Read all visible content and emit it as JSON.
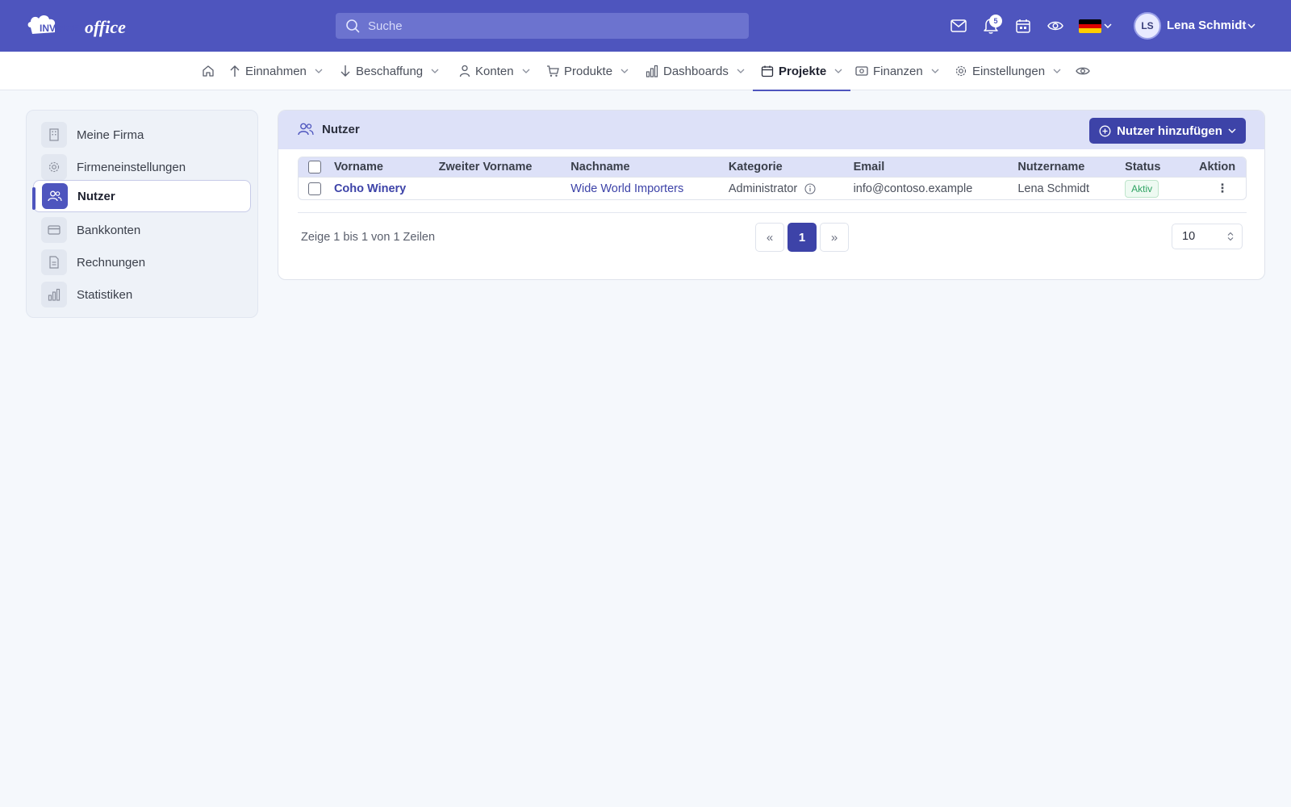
{
  "header": {
    "logo_text": "INVOICE office",
    "search_placeholder": "Suche",
    "notification_count": "5",
    "avatar_initials": "LS",
    "user_name": "Lena Schmidt"
  },
  "nav": {
    "items": [
      {
        "label": "Einnahmen",
        "icon": "arrow-up-icon"
      },
      {
        "label": "Beschaffung",
        "icon": "arrow-down-icon"
      },
      {
        "label": "Konten",
        "icon": "person-icon"
      },
      {
        "label": "Produkte",
        "icon": "cart-icon"
      },
      {
        "label": "Dashboards",
        "icon": "bar-chart-icon"
      },
      {
        "label": "Projekte",
        "icon": "calendar-icon",
        "active": true
      },
      {
        "label": "Finanzen",
        "icon": "money-icon"
      },
      {
        "label": "Einstellungen",
        "icon": "gear-icon"
      }
    ]
  },
  "sidebar": {
    "items": [
      {
        "label": "Meine Firma",
        "icon": "building-icon"
      },
      {
        "label": "Firmeneinstellungen",
        "icon": "gear-icon"
      },
      {
        "label": "Nutzer",
        "icon": "users-icon",
        "active": true
      },
      {
        "label": "Bankkonten",
        "icon": "credit-card-icon"
      },
      {
        "label": "Rechnungen",
        "icon": "document-icon"
      },
      {
        "label": "Statistiken",
        "icon": "bar-chart-icon"
      }
    ]
  },
  "main": {
    "title": "Nutzer",
    "add_button": "Nutzer hinzufügen",
    "table": {
      "columns": [
        "Vorname",
        "Zweiter Vorname",
        "Nachname",
        "Kategorie",
        "Email",
        "Nutzername",
        "Status",
        "Aktion"
      ],
      "rows": [
        {
          "vorname": "Coho Winery",
          "zweiter_vorname": "",
          "nachname": "Wide World Importers",
          "kategorie": "Administrator",
          "email": "info@contoso.example",
          "nutzername": "Lena Schmidt",
          "status": "Aktiv",
          "aktion": "⋮"
        }
      ]
    },
    "pagination": {
      "summary": "Zeige 1 bis 1 von 1 Zeilen",
      "prev": "«",
      "current": "1",
      "next": "»",
      "per_page": "10"
    }
  },
  "colors": {
    "brand": "#4e55be",
    "button": "#3d43a8",
    "status_active": "#2fa363"
  }
}
